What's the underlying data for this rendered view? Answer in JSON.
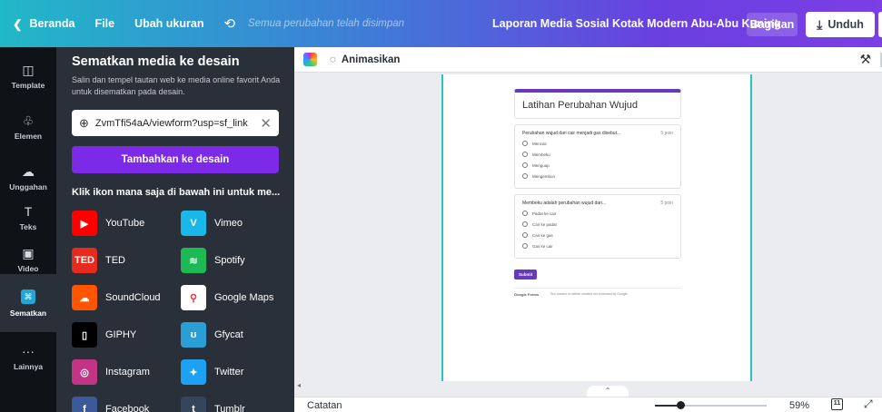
{
  "topbar": {
    "back_label": "Beranda",
    "file_label": "File",
    "resize_label": "Ubah ukuran",
    "undo_icon": "undo-icon",
    "saved_status": "Semua perubahan telah disimpan",
    "doc_title": "Laporan Media Sosial Kotak Modern Abu-Abu Kuning",
    "share_label": "Bagikan",
    "download_label": "Unduh"
  },
  "rail": {
    "items": [
      {
        "label": "Template",
        "icon": "template-icon",
        "glyph": "◫"
      },
      {
        "label": "Elemen",
        "icon": "elements-icon",
        "glyph": "♧"
      },
      {
        "label": "Unggahan",
        "icon": "upload-cloud-icon",
        "glyph": "☁"
      },
      {
        "label": "Teks",
        "icon": "text-icon",
        "glyph": "T"
      },
      {
        "label": "Video",
        "icon": "video-icon",
        "glyph": "▣"
      },
      {
        "label": "Sematkan",
        "icon": "embed-icon",
        "glyph": "⌘"
      },
      {
        "label": "Lainnya",
        "icon": "more-icon",
        "glyph": "···"
      }
    ]
  },
  "panel": {
    "title": "Sematkan media ke desain",
    "description": "Salin dan tempel tautan web ke media online favorit Anda untuk disematkan pada desain.",
    "url_value": "ZvmTfi54aA/viewform?usp=sf_link",
    "add_button": "Tambahkan ke desain",
    "hint": "Klik ikon mana saja di bawah ini untuk me...",
    "apps": [
      {
        "name": "YouTube",
        "color": "#ff0000",
        "glyph": "▶"
      },
      {
        "name": "Vimeo",
        "color": "#1ab7ea",
        "glyph": "V"
      },
      {
        "name": "TED",
        "color": "#e62b1e",
        "glyph": "TED"
      },
      {
        "name": "Spotify",
        "color": "#1db954",
        "glyph": "≋"
      },
      {
        "name": "SoundCloud",
        "color": "#ff5500",
        "glyph": "☁"
      },
      {
        "name": "Google Maps",
        "color": "#ffffff",
        "glyph": "⚲"
      },
      {
        "name": "GIPHY",
        "color": "#000000",
        "glyph": "▯"
      },
      {
        "name": "Gfycat",
        "color": "#2a9fd6",
        "glyph": "ʊ"
      },
      {
        "name": "Instagram",
        "color": "#c13584",
        "glyph": "◎"
      },
      {
        "name": "Twitter",
        "color": "#1da1f2",
        "glyph": "✦"
      },
      {
        "name": "Facebook",
        "color": "#3b5998",
        "glyph": "f"
      },
      {
        "name": "Tumblr",
        "color": "#35465c",
        "glyph": "t"
      }
    ]
  },
  "toolbar": {
    "animate_label": "Animasikan"
  },
  "form": {
    "title": "Latihan Perubahan Wujud",
    "questions": [
      {
        "text": "Perubahan wujud dari cair menjadi gas disebut...",
        "points": "5 poin",
        "options": [
          "Mencair",
          "Membeku",
          "Menguap",
          "Mengembun"
        ]
      },
      {
        "text": "Membeku adalah perubahan wujud dari...",
        "points": "5 poin",
        "options": [
          "Padat ke cair",
          "Cair ke padat",
          "Cair ke gas",
          "Gas ke cair"
        ]
      }
    ],
    "submit": "Submit",
    "footer_brand": "Google Forms",
    "footer_note": "This content is neither created nor endorsed by Google."
  },
  "bottombar": {
    "notes_label": "Catatan",
    "zoom_text": "59%",
    "zoom_fraction": 0.23,
    "page_count": "11"
  }
}
